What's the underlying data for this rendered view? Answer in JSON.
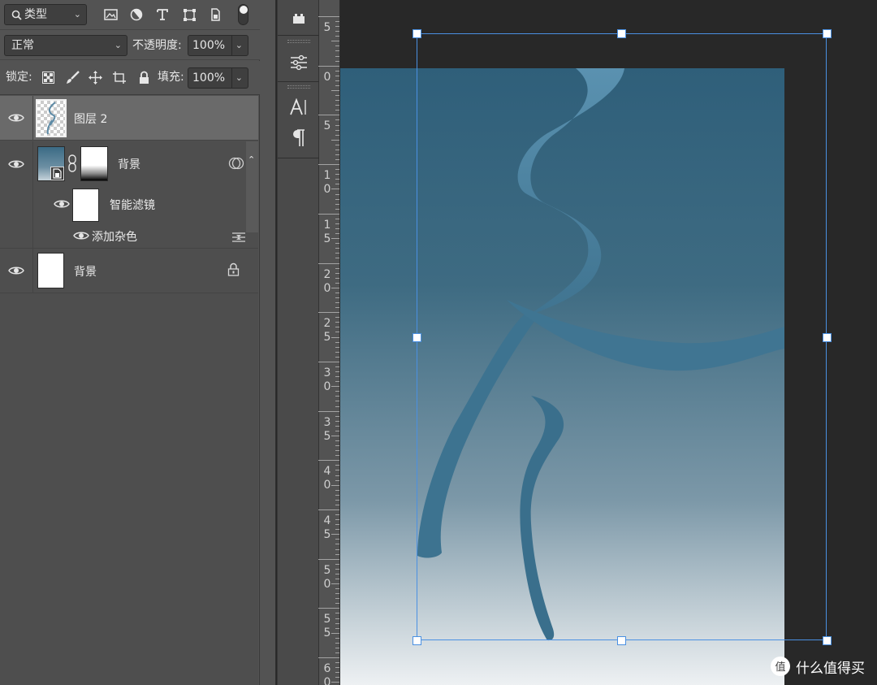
{
  "toolbar1": {
    "filter_kind": "类型"
  },
  "toolbar2": {
    "blend_mode": "正常",
    "opacity_label": "不透明度:",
    "opacity_value": "100%"
  },
  "toolbar3": {
    "lock_label": "锁定:",
    "fill_label": "填充:",
    "fill_value": "100%"
  },
  "layers": {
    "layer2_name": "图层 2",
    "smart_object_name": "背景",
    "smart_filters_label": "智能滤镜",
    "filter_add_noise": "添加杂色",
    "background_name": "背景"
  },
  "ruler": {
    "labels": [
      {
        "d1": "5",
        "d2": ""
      },
      {
        "d1": "0",
        "d2": ""
      },
      {
        "d1": "5",
        "d2": ""
      },
      {
        "d1": "1",
        "d2": "0"
      },
      {
        "d1": "1",
        "d2": "5"
      },
      {
        "d1": "2",
        "d2": "0"
      },
      {
        "d1": "2",
        "d2": "5"
      },
      {
        "d1": "3",
        "d2": "0"
      },
      {
        "d1": "3",
        "d2": "5"
      },
      {
        "d1": "4",
        "d2": "0"
      },
      {
        "d1": "4",
        "d2": "5"
      },
      {
        "d1": "5",
        "d2": "0"
      },
      {
        "d1": "5",
        "d2": "5"
      },
      {
        "d1": "6",
        "d2": "0"
      }
    ]
  },
  "watermark": {
    "text": "什么值得买",
    "logo_symbol": "值"
  },
  "colors": {
    "panel_bg": "#535353",
    "selection_blue": "#4a90e2"
  }
}
